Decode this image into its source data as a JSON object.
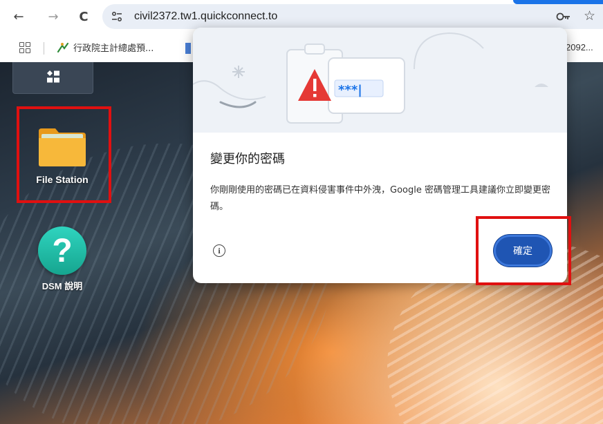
{
  "browser": {
    "back_icon": "back-arrow-icon",
    "forward_icon": "forward-arrow-icon",
    "reload_icon": "reload-icon",
    "url": "civil2372.tw1.quickconnect.to",
    "back_glyph": "←",
    "forward_glyph": "→",
    "reload_glyph": "C",
    "star_glyph": "☆"
  },
  "bookmarks": {
    "items": [
      {
        "label": "行政院主計總處預..."
      },
      {
        "label": ""
      }
    ],
    "right_label": "2092..."
  },
  "desktop": {
    "apps": [
      {
        "label": "File Station",
        "icon": "folder-icon"
      },
      {
        "label": "DSM 說明",
        "icon": "help-icon",
        "glyph": "?"
      }
    ]
  },
  "dialog": {
    "title": "變更你的密碼",
    "body": "你剛剛使用的密碼已在資料侵害事件中外洩，Google 密碼管理工具建議你立即變更密碼。",
    "password_mask": "***|",
    "info_glyph": "i",
    "ok_label": "確定"
  },
  "colors": {
    "highlight": "#e01010",
    "ok_button": "#1f55b3",
    "warning": "#e53935"
  }
}
